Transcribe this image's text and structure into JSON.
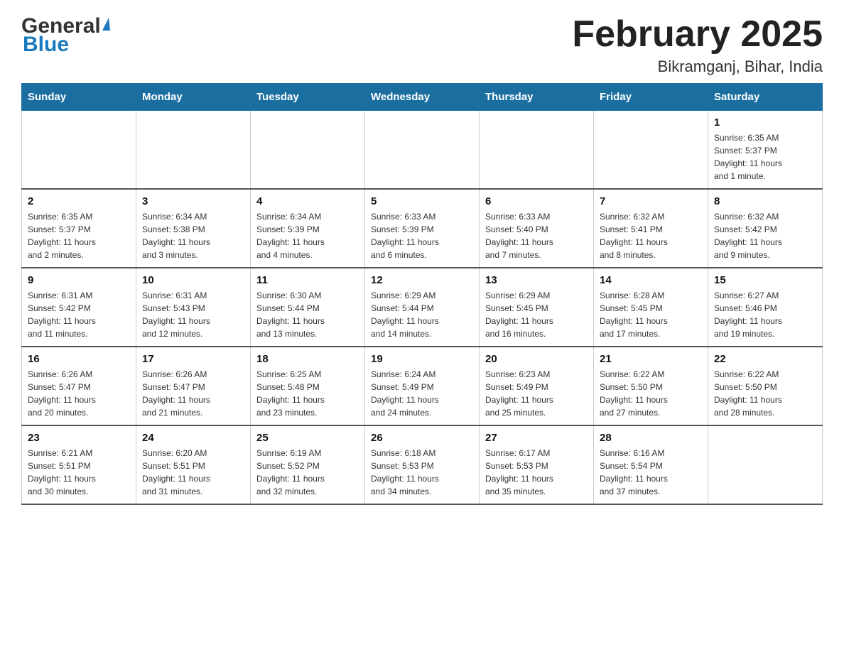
{
  "header": {
    "logo_general": "General",
    "logo_blue": "Blue",
    "title": "February 2025",
    "subtitle": "Bikramganj, Bihar, India"
  },
  "weekdays": [
    "Sunday",
    "Monday",
    "Tuesday",
    "Wednesday",
    "Thursday",
    "Friday",
    "Saturday"
  ],
  "weeks": [
    [
      {
        "day": "",
        "info": ""
      },
      {
        "day": "",
        "info": ""
      },
      {
        "day": "",
        "info": ""
      },
      {
        "day": "",
        "info": ""
      },
      {
        "day": "",
        "info": ""
      },
      {
        "day": "",
        "info": ""
      },
      {
        "day": "1",
        "info": "Sunrise: 6:35 AM\nSunset: 5:37 PM\nDaylight: 11 hours\nand 1 minute."
      }
    ],
    [
      {
        "day": "2",
        "info": "Sunrise: 6:35 AM\nSunset: 5:37 PM\nDaylight: 11 hours\nand 2 minutes."
      },
      {
        "day": "3",
        "info": "Sunrise: 6:34 AM\nSunset: 5:38 PM\nDaylight: 11 hours\nand 3 minutes."
      },
      {
        "day": "4",
        "info": "Sunrise: 6:34 AM\nSunset: 5:39 PM\nDaylight: 11 hours\nand 4 minutes."
      },
      {
        "day": "5",
        "info": "Sunrise: 6:33 AM\nSunset: 5:39 PM\nDaylight: 11 hours\nand 6 minutes."
      },
      {
        "day": "6",
        "info": "Sunrise: 6:33 AM\nSunset: 5:40 PM\nDaylight: 11 hours\nand 7 minutes."
      },
      {
        "day": "7",
        "info": "Sunrise: 6:32 AM\nSunset: 5:41 PM\nDaylight: 11 hours\nand 8 minutes."
      },
      {
        "day": "8",
        "info": "Sunrise: 6:32 AM\nSunset: 5:42 PM\nDaylight: 11 hours\nand 9 minutes."
      }
    ],
    [
      {
        "day": "9",
        "info": "Sunrise: 6:31 AM\nSunset: 5:42 PM\nDaylight: 11 hours\nand 11 minutes."
      },
      {
        "day": "10",
        "info": "Sunrise: 6:31 AM\nSunset: 5:43 PM\nDaylight: 11 hours\nand 12 minutes."
      },
      {
        "day": "11",
        "info": "Sunrise: 6:30 AM\nSunset: 5:44 PM\nDaylight: 11 hours\nand 13 minutes."
      },
      {
        "day": "12",
        "info": "Sunrise: 6:29 AM\nSunset: 5:44 PM\nDaylight: 11 hours\nand 14 minutes."
      },
      {
        "day": "13",
        "info": "Sunrise: 6:29 AM\nSunset: 5:45 PM\nDaylight: 11 hours\nand 16 minutes."
      },
      {
        "day": "14",
        "info": "Sunrise: 6:28 AM\nSunset: 5:45 PM\nDaylight: 11 hours\nand 17 minutes."
      },
      {
        "day": "15",
        "info": "Sunrise: 6:27 AM\nSunset: 5:46 PM\nDaylight: 11 hours\nand 19 minutes."
      }
    ],
    [
      {
        "day": "16",
        "info": "Sunrise: 6:26 AM\nSunset: 5:47 PM\nDaylight: 11 hours\nand 20 minutes."
      },
      {
        "day": "17",
        "info": "Sunrise: 6:26 AM\nSunset: 5:47 PM\nDaylight: 11 hours\nand 21 minutes."
      },
      {
        "day": "18",
        "info": "Sunrise: 6:25 AM\nSunset: 5:48 PM\nDaylight: 11 hours\nand 23 minutes."
      },
      {
        "day": "19",
        "info": "Sunrise: 6:24 AM\nSunset: 5:49 PM\nDaylight: 11 hours\nand 24 minutes."
      },
      {
        "day": "20",
        "info": "Sunrise: 6:23 AM\nSunset: 5:49 PM\nDaylight: 11 hours\nand 25 minutes."
      },
      {
        "day": "21",
        "info": "Sunrise: 6:22 AM\nSunset: 5:50 PM\nDaylight: 11 hours\nand 27 minutes."
      },
      {
        "day": "22",
        "info": "Sunrise: 6:22 AM\nSunset: 5:50 PM\nDaylight: 11 hours\nand 28 minutes."
      }
    ],
    [
      {
        "day": "23",
        "info": "Sunrise: 6:21 AM\nSunset: 5:51 PM\nDaylight: 11 hours\nand 30 minutes."
      },
      {
        "day": "24",
        "info": "Sunrise: 6:20 AM\nSunset: 5:51 PM\nDaylight: 11 hours\nand 31 minutes."
      },
      {
        "day": "25",
        "info": "Sunrise: 6:19 AM\nSunset: 5:52 PM\nDaylight: 11 hours\nand 32 minutes."
      },
      {
        "day": "26",
        "info": "Sunrise: 6:18 AM\nSunset: 5:53 PM\nDaylight: 11 hours\nand 34 minutes."
      },
      {
        "day": "27",
        "info": "Sunrise: 6:17 AM\nSunset: 5:53 PM\nDaylight: 11 hours\nand 35 minutes."
      },
      {
        "day": "28",
        "info": "Sunrise: 6:16 AM\nSunset: 5:54 PM\nDaylight: 11 hours\nand 37 minutes."
      },
      {
        "day": "",
        "info": ""
      }
    ]
  ]
}
